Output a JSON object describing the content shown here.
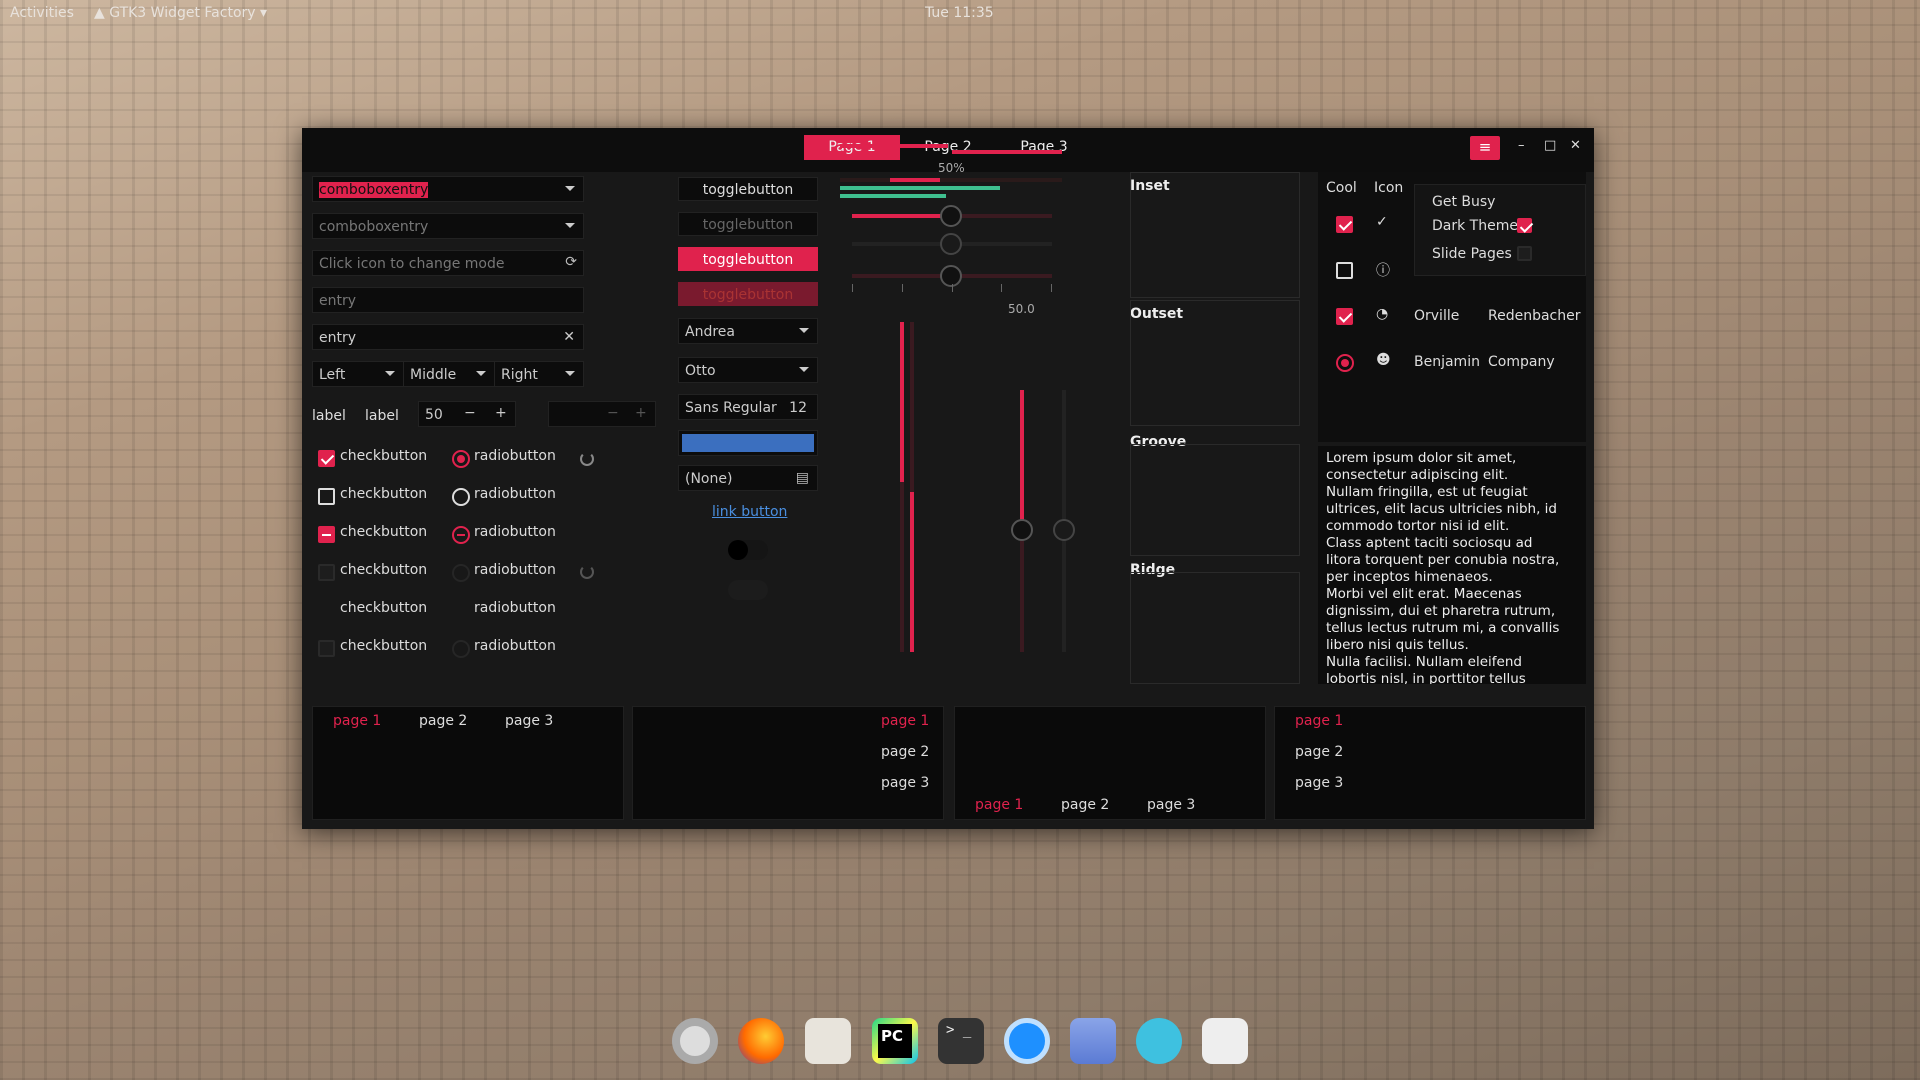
{
  "topbar": {
    "activities": "Activities",
    "app": "GTK3 Widget Factory",
    "clock": "Tue 11:35"
  },
  "window": {
    "tabs": [
      "Page 1",
      "Page 2",
      "Page 3"
    ],
    "menu_icon": "hamburger-icon"
  },
  "left": {
    "combo1": "comboboxentry",
    "combo2": "comboboxentry",
    "mode_placeholder": "Click icon to change mode",
    "entry1": "entry",
    "entry2": "entry",
    "aligns": [
      "Left",
      "Middle",
      "Right"
    ],
    "label1": "label",
    "label2": "label",
    "spin_value": "50",
    "checks": [
      {
        "check": "checkbutton",
        "radio": "radiobutton"
      },
      {
        "check": "checkbutton",
        "radio": "radiobutton"
      },
      {
        "check": "checkbutton",
        "radio": "radiobutton"
      },
      {
        "check": "checkbutton",
        "radio": "radiobutton"
      },
      {
        "check": "checkbutton",
        "radio": "radiobutton"
      },
      {
        "check": "checkbutton",
        "radio": "radiobutton"
      }
    ]
  },
  "mid": {
    "toggles": [
      "togglebutton",
      "togglebutton",
      "togglebutton",
      "togglebutton"
    ],
    "combo_a": "Andrea",
    "combo_o": "Otto",
    "font_name": "Sans Regular",
    "font_size": "12",
    "color_value": "#3b6fbf",
    "file": "(None)",
    "link": "link button"
  },
  "scales": {
    "progress_label": "50%",
    "progress_value": 0.5,
    "vscale_label": "50.0",
    "scale_values": [
      0.5,
      0.5,
      0.5
    ]
  },
  "frames": [
    "Inset",
    "Outset",
    "Groove",
    "Ridge"
  ],
  "tree": {
    "headers": [
      "Cool",
      "Icon"
    ],
    "rows": [
      {
        "first": "",
        "last": ""
      },
      {
        "first": "",
        "last": ""
      },
      {
        "first": "Orville",
        "last": "Redenbacher"
      },
      {
        "first": "Benjamin",
        "last": "Company"
      }
    ]
  },
  "popover": {
    "items": [
      "Get Busy",
      "Dark Theme",
      "Slide Pages"
    ]
  },
  "text": {
    "lines": [
      "Lorem ipsum dolor sit amet,",
      "consectetur adipiscing elit.",
      "Nullam fringilla, est ut feugiat",
      "ultrices, elit lacus ultricies nibh, id",
      "commodo tortor nisi id elit.",
      "Class aptent taciti sociosqu ad",
      "litora torquent per conubia nostra,",
      "per inceptos himenaeos.",
      "Morbi vel elit erat. Maecenas",
      "dignissim, dui et pharetra rutrum,",
      "tellus lectus rutrum mi, a convallis",
      "libero nisi quis tellus.",
      "Nulla facilisi. Nullam eleifend",
      "lobortis nisl, in porttitor tellus"
    ]
  },
  "notebooks": {
    "pages": [
      "page 1",
      "page 2",
      "page 3"
    ]
  },
  "dock": [
    "help-icon",
    "firefox-icon",
    "files-icon",
    "pycharm-icon",
    "terminal-icon",
    "browser-icon",
    "mail-icon",
    "audio-icon",
    "settings-icon"
  ],
  "colors": {
    "accent": "#e0224d",
    "bg": "#181818"
  }
}
